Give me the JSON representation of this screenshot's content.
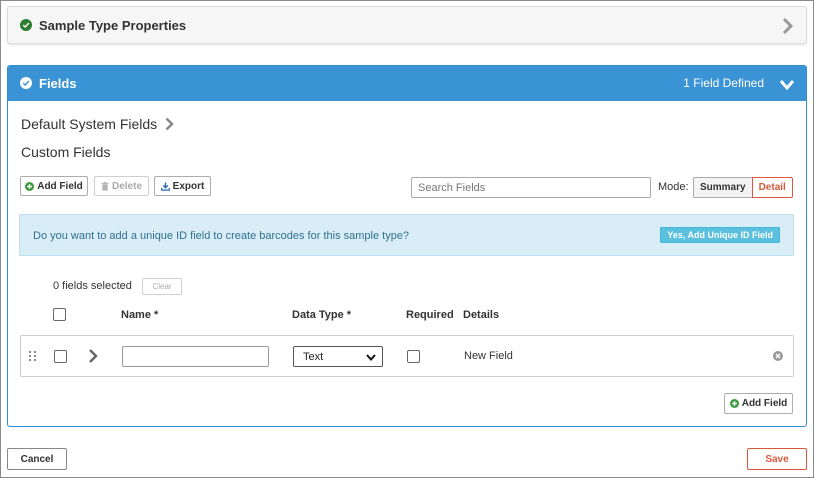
{
  "props_panel": {
    "title": "Sample Type Properties"
  },
  "fields_panel": {
    "title": "Fields",
    "defined_count": "1 Field Defined",
    "default_system_fields": "Default System Fields",
    "custom_fields": "Custom Fields"
  },
  "toolbar": {
    "add_field": "Add Field",
    "delete": "Delete",
    "export": "Export"
  },
  "search": {
    "placeholder": "Search Fields"
  },
  "mode": {
    "label": "Mode:",
    "summary": "Summary",
    "detail": "Detail"
  },
  "alert": {
    "text": "Do you want to add a unique ID field to create barcodes for this sample type?",
    "button": "Yes, Add Unique ID Field"
  },
  "selection": {
    "count": "0 fields selected",
    "clear": "Clear"
  },
  "columns": {
    "name": "Name *",
    "data_type": "Data Type *",
    "required": "Required",
    "details": "Details"
  },
  "row": {
    "name_value": "",
    "data_type": "Text",
    "details": "New Field"
  },
  "bottom": {
    "add_field": "Add Field"
  },
  "footer": {
    "cancel": "Cancel",
    "save": "Save"
  },
  "colors": {
    "header_blue": "#3a93d4",
    "success_green": "#2e7d32",
    "alert_bg": "#d9edf7",
    "alert_button": "#5bc0de",
    "save_accent": "#d9583b"
  }
}
